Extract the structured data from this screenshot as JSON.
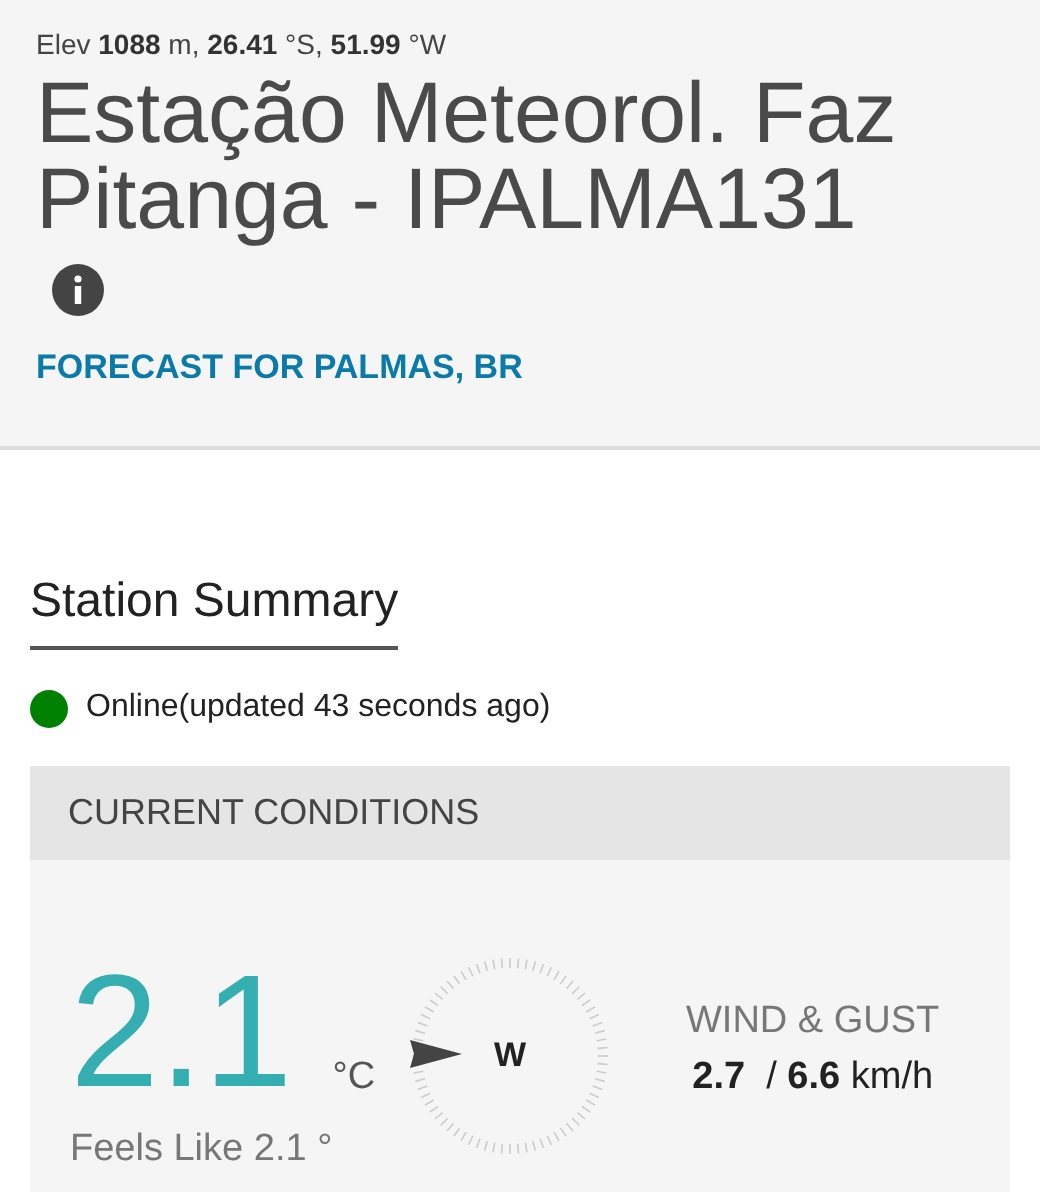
{
  "header": {
    "location": "Elev **1088** m, **26.41** °S, **51.99** °W",
    "title": "Estação Meteorol. Faz Pitanga - IPALMA131",
    "forecast_link": "FORECAST FOR PALMAS, BR"
  },
  "summary": {
    "heading": "Station Summary",
    "status": {
      "text": "Online(updated 43 seconds ago)",
      "color": "#008000"
    }
  },
  "current_conditions": {
    "heading": "CURRENT CONDITIONS",
    "temperature": "2.1",
    "unit": "°C",
    "feels_like": "Feels Like 2.1 °",
    "wind_direction": "W",
    "wind_label": "WIND & GUST",
    "wind_value": "**2.7**  / **6.6** km/h"
  }
}
